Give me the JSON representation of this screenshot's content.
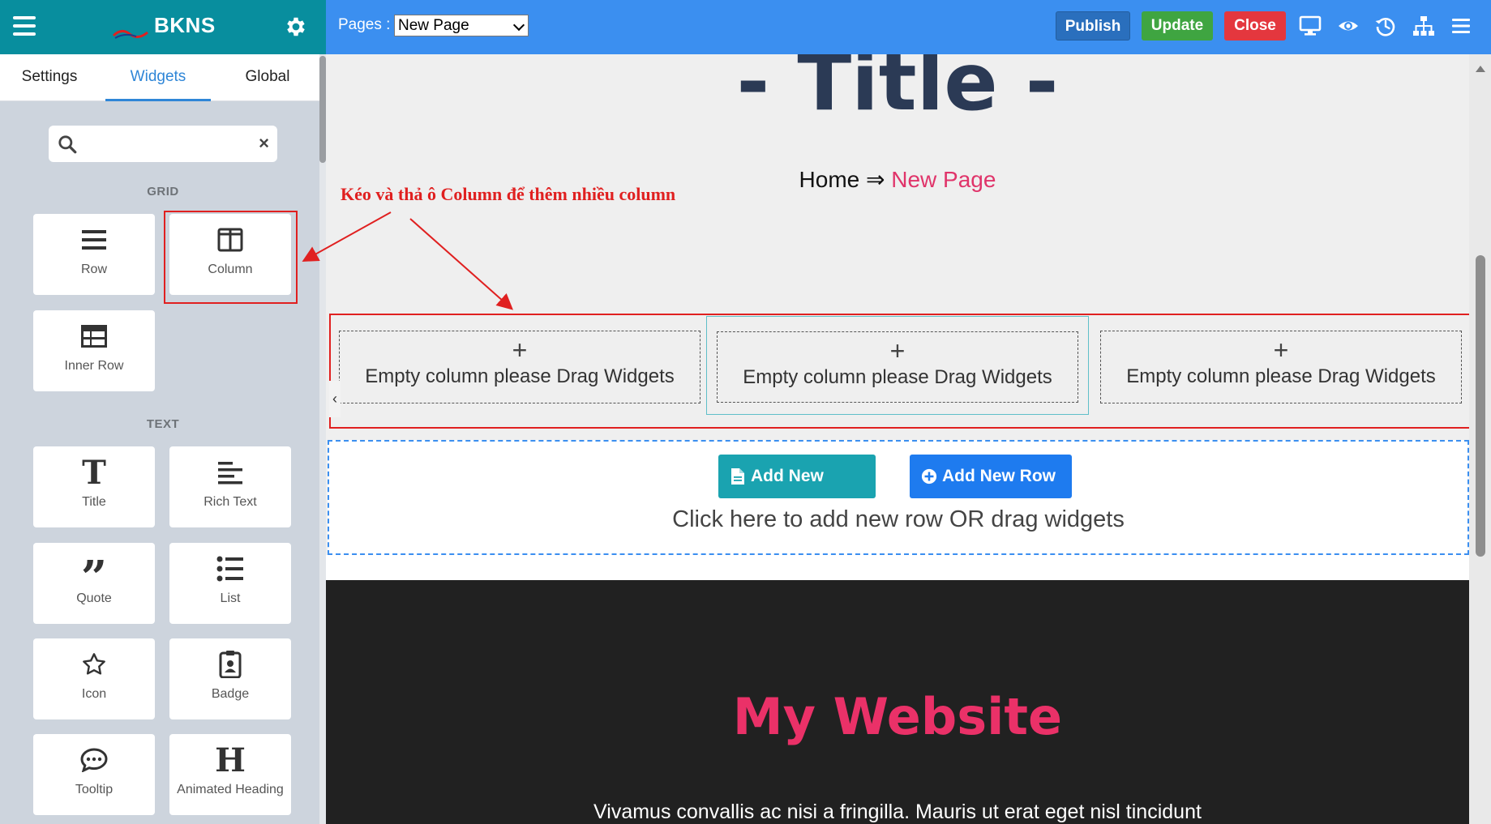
{
  "sidebar": {
    "brand": "BKNS",
    "tabs": [
      "Settings",
      "Widgets",
      "Global"
    ],
    "active_tab": "Widgets",
    "search": {
      "placeholder": "",
      "value": ""
    },
    "categories": {
      "grid": "GRID",
      "text": "TEXT"
    },
    "widgets": {
      "row": "Row",
      "column": "Column",
      "inner_row": "Inner Row",
      "title": "Title",
      "rich_text": "Rich Text",
      "quote": "Quote",
      "list": "List",
      "icon": "Icon",
      "badge": "Badge",
      "tooltip": "Tooltip",
      "animated_heading": "Animated Heading"
    }
  },
  "topbar": {
    "pages_label": "Pages :",
    "pages_selected": "New Page",
    "publish": "Publish",
    "update": "Update",
    "close": "Close",
    "icons": [
      "desktop-icon",
      "eye-icon",
      "history-icon",
      "sitemap-icon",
      "menu-icon"
    ]
  },
  "canvas": {
    "page_title": "- Title -",
    "breadcrumb": {
      "home": "Home",
      "sep": "⇒",
      "current": "New Page"
    },
    "annotation": "Kéo và thả ô Column để thêm nhiều column",
    "columns": [
      {
        "plus": "+",
        "text": "Empty column please Drag Widgets"
      },
      {
        "plus": "+",
        "text": "Empty column please Drag Widgets"
      },
      {
        "plus": "+",
        "text": "Empty column please Drag Widgets"
      }
    ],
    "collapse": "‹",
    "add_section": "Add New Section",
    "add_row": "Add New Row",
    "add_hint": "Click here to add new row OR drag widgets",
    "footer_title": "My Website",
    "footer_text": "Vivamus convallis ac nisi a fringilla. Mauris ut erat eget nisl tincidunt"
  },
  "colors": {
    "sidebar_header": "#088e9e",
    "topbar": "#3b8ff0",
    "publish": "#2a6fbd",
    "update": "#3fa541",
    "close": "#e4373e",
    "accent_pink": "#ea3168",
    "annotation_red": "#e02020"
  }
}
